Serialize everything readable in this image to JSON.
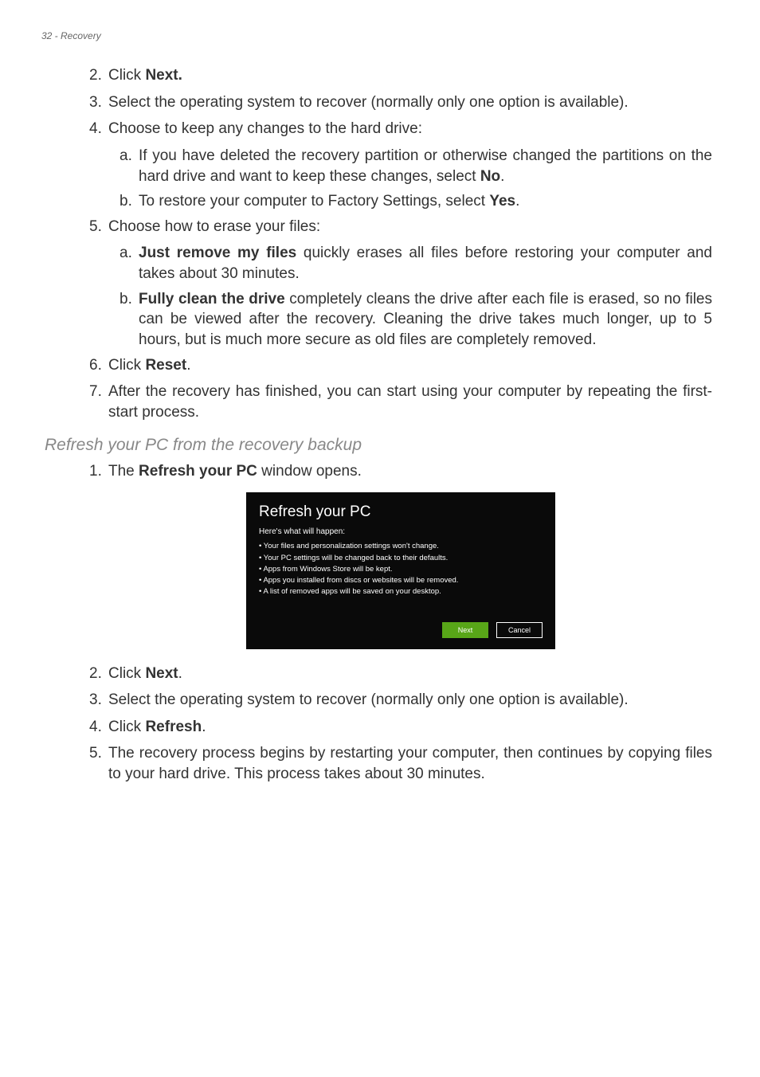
{
  "header": "32 - Recovery",
  "steps_a": [
    {
      "n": "2.",
      "pre": "Click ",
      "bold": "Next.",
      "post": ""
    },
    {
      "n": "3.",
      "pre": "Select the operating system to recover (normally only one option is available).",
      "bold": "",
      "post": ""
    },
    {
      "n": "4.",
      "pre": "Choose to keep any changes to the hard drive:",
      "bold": "",
      "post": ""
    }
  ],
  "sub_4": [
    {
      "n": "a.",
      "pre": "If you have deleted the recovery partition or otherwise changed the partitions on the hard drive and want to keep these changes, select ",
      "bold": "No",
      "post": "."
    },
    {
      "n": "b.",
      "pre": "To restore your computer to Factory Settings, select ",
      "bold": "Yes",
      "post": "."
    }
  ],
  "step_5": {
    "n": "5.",
    "pre": "Choose how to erase your files:",
    "bold": "",
    "post": ""
  },
  "sub_5": [
    {
      "n": "a.",
      "bold": "Just remove my files",
      "post": " quickly erases all files before restoring your computer and takes about 30 minutes."
    },
    {
      "n": "b.",
      "bold": "Fully clean the drive",
      "post": " completely cleans the drive after each file is erased, so no files can be viewed after the recovery. Cleaning the drive takes much longer, up to 5 hours, but is much more secure as old files are completely removed."
    }
  ],
  "step_6": {
    "n": "6.",
    "pre": "Click ",
    "bold": "Reset",
    "post": "."
  },
  "step_7": {
    "n": "7.",
    "pre": "After the recovery has finished, you can start using your computer by repeating the first-start process.",
    "bold": "",
    "post": ""
  },
  "section_title": "Refresh your PC from the recovery backup",
  "step_b1": {
    "n": "1.",
    "pre": "The ",
    "bold": "Refresh your PC",
    "post": " window opens."
  },
  "dialog": {
    "title": "Refresh your PC",
    "subtitle": "Here's what will happen:",
    "items": [
      "• Your files and personalization settings won't change.",
      "• Your PC settings will be changed back to their defaults.",
      "• Apps from Windows Store will be kept.",
      "• Apps you installed from discs or websites will be removed.",
      "• A list of removed apps will be saved on your desktop."
    ],
    "next": "Next",
    "cancel": "Cancel"
  },
  "steps_b": [
    {
      "n": "2.",
      "pre": "Click ",
      "bold": "Next",
      "post": "."
    },
    {
      "n": "3.",
      "pre": "Select the operating system to recover (normally only one option is available).",
      "bold": "",
      "post": ""
    },
    {
      "n": "4.",
      "pre": "Click ",
      "bold": "Refresh",
      "post": "."
    },
    {
      "n": "5.",
      "pre": "The recovery process begins by restarting your computer, then continues by copying files to your hard drive. This process takes about 30 minutes.",
      "bold": "",
      "post": ""
    }
  ]
}
